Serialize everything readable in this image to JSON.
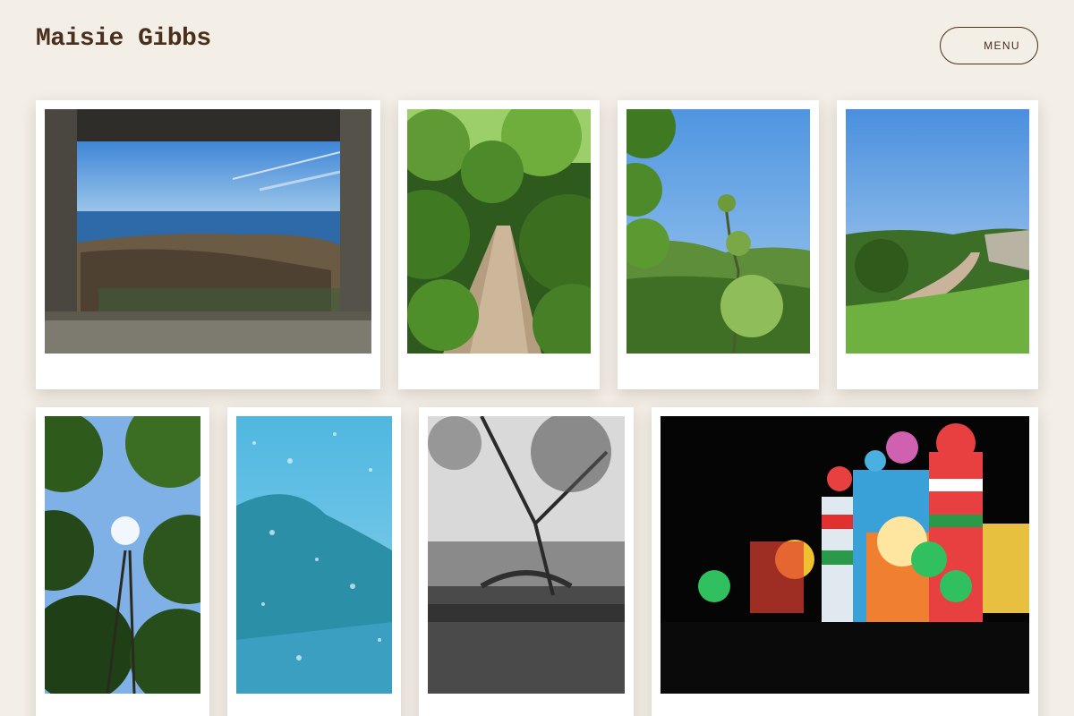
{
  "header": {
    "site_title": "Maisie Gibbs",
    "menu_label": "MENU"
  },
  "colors": {
    "background": "#f3eee6",
    "brand_text": "#4a2f1c",
    "card": "#ffffff"
  },
  "gallery": {
    "photos": [
      {
        "subject": "stone window framing a rocky seashore and blue sky"
      },
      {
        "subject": "dirt path through a lush green wooded lane"
      },
      {
        "subject": "tree branch against blue sky above green valley"
      },
      {
        "subject": "river winding through a green gorge"
      },
      {
        "subject": "looking up at a tree canopy with sun"
      },
      {
        "subject": "raindrops on a window with blue sky"
      },
      {
        "subject": "black and white tree over a riverside bridge"
      },
      {
        "subject": "illuminated lantern palace at night"
      }
    ]
  }
}
